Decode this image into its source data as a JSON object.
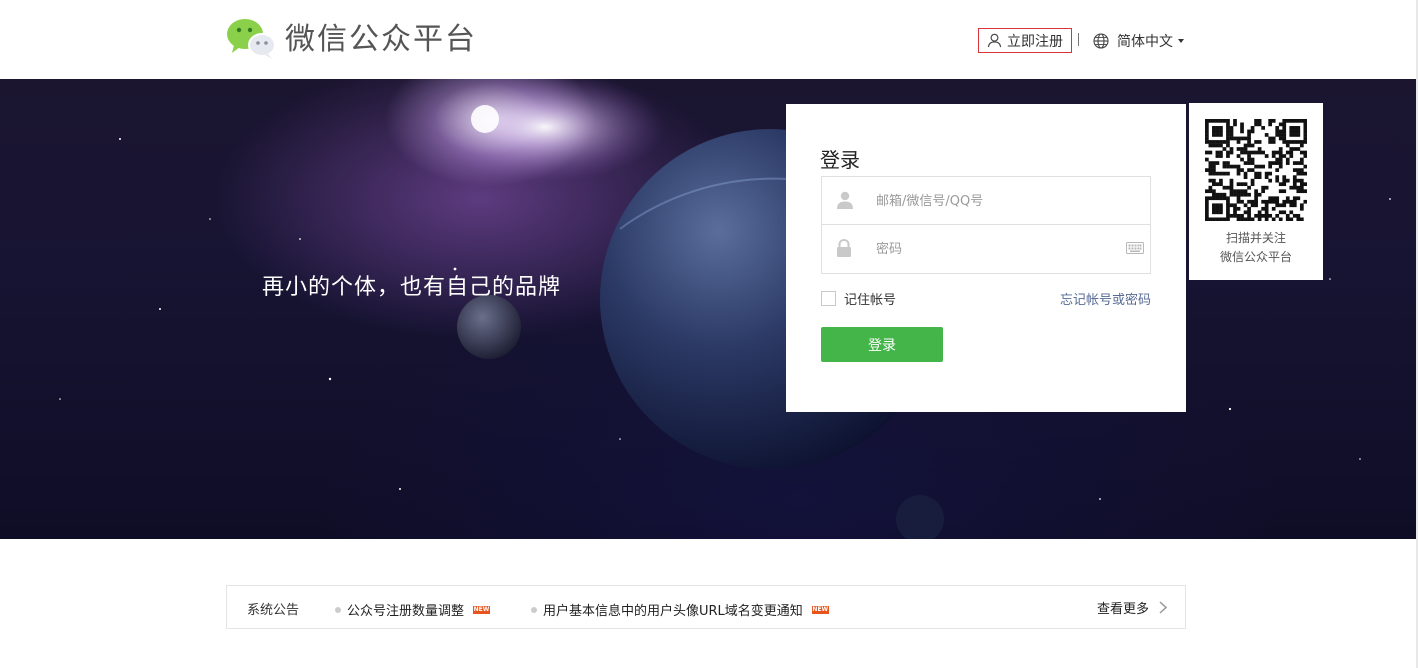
{
  "header": {
    "title": "微信公众平台",
    "register_label": "立即注册",
    "language_label": "简体中文"
  },
  "banner": {
    "slogan": "再小的个体，也有自己的品牌"
  },
  "login": {
    "title": "登录",
    "username_placeholder": "邮箱/微信号/QQ号",
    "password_placeholder": "密码",
    "remember_label": "记住帐号",
    "forgot_label": "忘记帐号或密码",
    "submit_label": "登录"
  },
  "qr": {
    "line1": "扫描并关注",
    "line2": "微信公众平台"
  },
  "notice": {
    "label": "系统公告",
    "items": [
      {
        "text": "公众号注册数量调整",
        "badge": "NEW"
      },
      {
        "text": "用户基本信息中的用户头像URL域名变更通知",
        "badge": "NEW"
      }
    ],
    "more_label": "查看更多"
  },
  "colors": {
    "accent_green": "#44b549",
    "link_blue": "#576b95",
    "register_border": "#d9353b",
    "badge_orange": "#e8541e"
  }
}
